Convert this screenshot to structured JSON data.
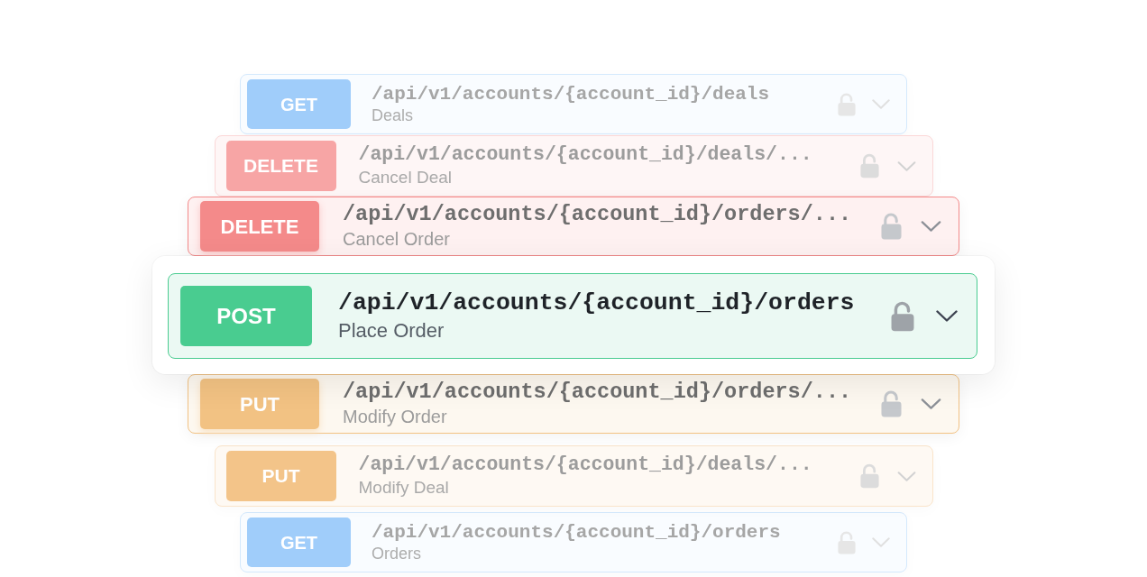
{
  "endpoints": [
    {
      "method": "GET",
      "path": "/api/v1/accounts/{account_id}/deals",
      "summary": "Deals",
      "color": "#a0cdfa",
      "selected": false
    },
    {
      "method": "DELETE",
      "path": "/api/v1/accounts/{account_id}/deals/...",
      "summary": "Cancel Deal",
      "color": "#f7a5a5",
      "selected": false
    },
    {
      "method": "DELETE",
      "path": "/api/v1/accounts/{account_id}/orders/...",
      "summary": "Cancel Order",
      "color": "#f48a8a",
      "selected": false
    },
    {
      "method": "POST",
      "path": "/api/v1/accounts/{account_id}/orders",
      "summary": "Place Order",
      "color": "#49cc90",
      "selected": true
    },
    {
      "method": "PUT",
      "path": "/api/v1/accounts/{account_id}/orders/...",
      "summary": "Modify Order",
      "color": "#f2c283",
      "selected": false
    },
    {
      "method": "PUT",
      "path": "/api/v1/accounts/{account_id}/deals/...",
      "summary": "Modify Deal",
      "color": "#f3c489",
      "selected": false
    },
    {
      "method": "GET",
      "path": "/api/v1/accounts/{account_id}/orders",
      "summary": "Orders",
      "color": "#a0cdfa",
      "selected": false
    }
  ]
}
